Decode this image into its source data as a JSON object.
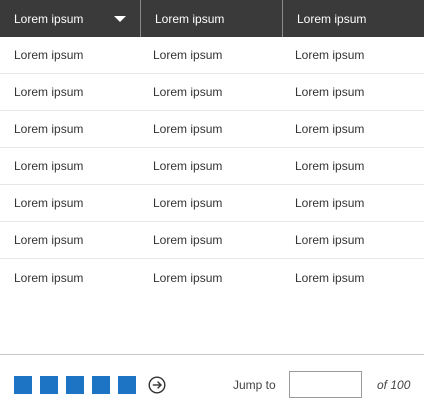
{
  "header": {
    "columns": [
      {
        "label": "Lorem ipsum",
        "sortable": true,
        "sort_icon": "chevron-down-icon"
      },
      {
        "label": "Lorem ipsum"
      },
      {
        "label": "Lorem ipsum"
      }
    ]
  },
  "rows": [
    {
      "cells": [
        "Lorem ipsum",
        "Lorem ipsum",
        "Lorem ipsum"
      ]
    },
    {
      "cells": [
        "Lorem ipsum",
        "Lorem ipsum",
        "Lorem ipsum"
      ]
    },
    {
      "cells": [
        "Lorem ipsum",
        "Lorem ipsum",
        "Lorem ipsum"
      ]
    },
    {
      "cells": [
        "Lorem ipsum",
        "Lorem ipsum",
        "Lorem ipsum"
      ]
    },
    {
      "cells": [
        "Lorem ipsum",
        "Lorem ipsum",
        "Lorem ipsum"
      ]
    },
    {
      "cells": [
        "Lorem ipsum",
        "Lorem ipsum",
        "Lorem ipsum"
      ]
    },
    {
      "cells": [
        "Lorem ipsum",
        "Lorem ipsum",
        "Lorem ipsum"
      ]
    }
  ],
  "pagination": {
    "page_squares": 5,
    "next_icon": "arrow-right-circle-icon",
    "jump_label": "Jump to",
    "jump_value": "",
    "total_label": "of 100"
  },
  "colors": {
    "header_bg": "#3a3a3a",
    "page_square": "#1e74c4",
    "row_border": "#e6e6e6"
  }
}
